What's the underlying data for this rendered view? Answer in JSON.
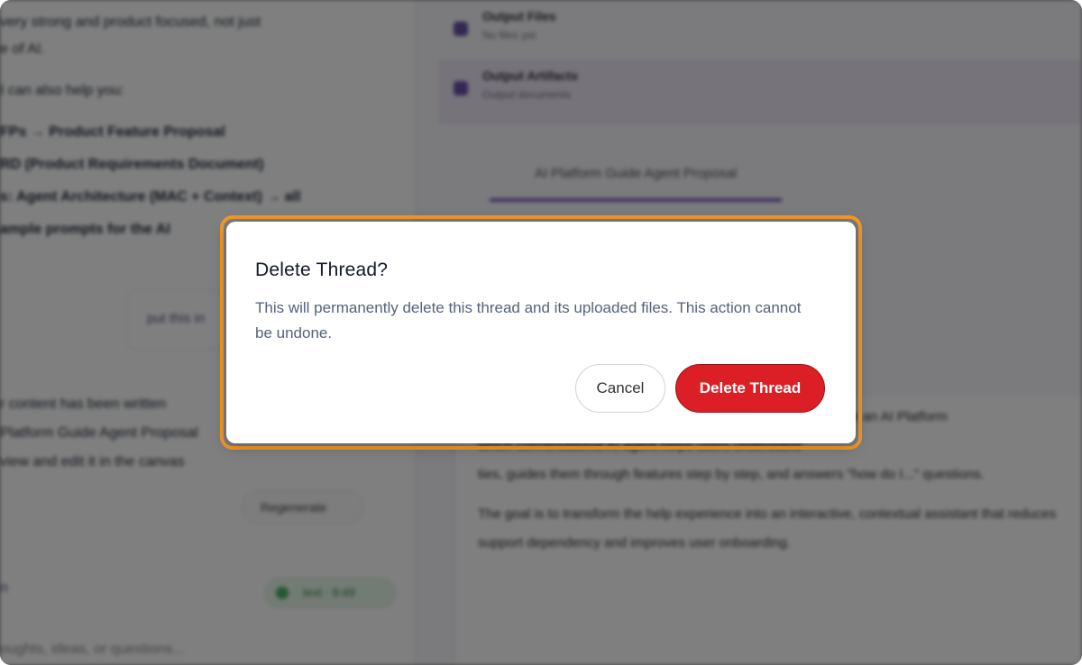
{
  "dialog": {
    "title": "Delete Thread?",
    "description": "This will permanently delete this thread and its uploaded files. This action cannot be undone.",
    "cancel_label": "Cancel",
    "confirm_label": "Delete Thread"
  },
  "background": {
    "left_lines": [
      "very strong and product focused, not just",
      "e of AI.",
      "I can also help you:",
      "FPs → Product Feature Proposal",
      "RD (Product Requirements Document)",
      "s: Agent Architecture (MAC + Context) → all",
      "ample prompts for the AI"
    ],
    "card_text": "put this in",
    "status_lines": [
      "r content has been written",
      "Platform Guide Agent Proposal",
      "view and edit it in the canvas"
    ],
    "regenerate_label": "Regenerate",
    "pill_label": "text · 9:49",
    "left_footer_a": "n",
    "input_placeholder": "oughts, ideas, or questions...",
    "files": [
      {
        "title": "Output Files",
        "subtitle": "No files yet"
      },
      {
        "title": "Output Artifacts",
        "subtitle": "Output documents"
      }
    ],
    "tab_label": "AI Platform Guide Agent Proposal",
    "doc_lines": [
      "platform can introduce an AI Platform",
      "which conversational AI agent helps users understand",
      "ties, guides them through features step by step, and answers \"how do I...\" questions.",
      "The goal is to transform the help experience into an interactive, contextual assistant that reduces",
      "support dependency and improves user onboarding."
    ]
  },
  "colors": {
    "accent_highlight": "#f39a2c",
    "danger": "#dc1f26"
  }
}
